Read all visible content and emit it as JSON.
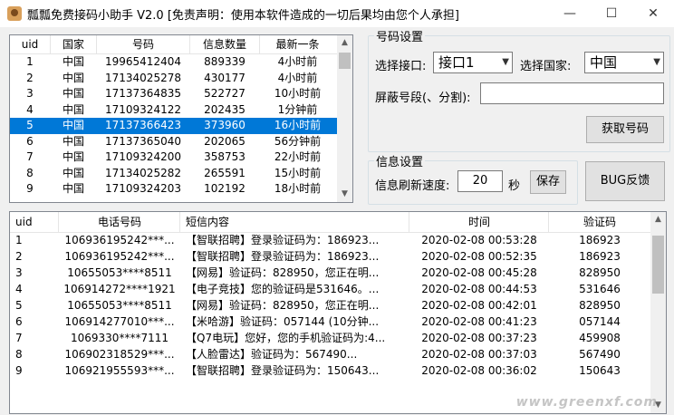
{
  "window": {
    "title": "瓢瓢免费接码小助手 V2.0 [免责声明：使用本软件造成的一切后果均由您个人承担]",
    "minimize": "—",
    "maximize": "☐",
    "close": "✕"
  },
  "numbers_table": {
    "columns": [
      "uid",
      "国家",
      "号码",
      "信息数量",
      "最新一条"
    ],
    "rows": [
      [
        "1",
        "中国",
        "19965412404",
        "889339",
        "4小时前"
      ],
      [
        "2",
        "中国",
        "17134025278",
        "430177",
        "4小时前"
      ],
      [
        "3",
        "中国",
        "17137364835",
        "522727",
        "10小时前"
      ],
      [
        "4",
        "中国",
        "17109324122",
        "202435",
        "1分钟前"
      ],
      [
        "5",
        "中国",
        "17137366423",
        "373960",
        "16小时前"
      ],
      [
        "6",
        "中国",
        "17137365040",
        "202065",
        "56分钟前"
      ],
      [
        "7",
        "中国",
        "17109324200",
        "358753",
        "22小时前"
      ],
      [
        "8",
        "中国",
        "17134025282",
        "265591",
        "15小时前"
      ],
      [
        "9",
        "中国",
        "17109324203",
        "102192",
        "18小时前"
      ]
    ],
    "selected_row": 4
  },
  "number_settings": {
    "legend": "号码设置",
    "interface_label": "选择接口:",
    "interface_value": "接口1",
    "country_label": "选择国家:",
    "country_value": "中国",
    "block_label": "屏蔽号段(、分割):",
    "block_value": "",
    "get_button": "获取号码"
  },
  "info_settings": {
    "legend": "信息设置",
    "refresh_label": "信息刷新速度:",
    "refresh_value": "20",
    "unit": "秒",
    "save_button": "保存"
  },
  "bug_button": "BUG反馈",
  "sms_table": {
    "columns": [
      "uid",
      "电话号码",
      "短信内容",
      "时间",
      "验证码"
    ],
    "rows": [
      [
        "1",
        "106936195242***...",
        "【智联招聘】登录验证码为：186923...",
        "2020-02-08 00:53:28",
        "186923"
      ],
      [
        "2",
        "106936195242***...",
        "【智联招聘】登录验证码为：186923...",
        "2020-02-08 00:52:35",
        "186923"
      ],
      [
        "3",
        "10655053****8511",
        "【网易】验证码：828950，您正在明...",
        "2020-02-08 00:45:28",
        "828950"
      ],
      [
        "4",
        "106914272****1921",
        "【电子竞技】您的验证码是531646。...",
        "2020-02-08 00:44:53",
        "531646"
      ],
      [
        "5",
        "10655053****8511",
        "【网易】验证码：828950，您正在明...",
        "2020-02-08 00:42:01",
        "828950"
      ],
      [
        "6",
        "106914277010***...",
        "【米哈游】验证码：057144 (10分钟...",
        "2020-02-08 00:41:23",
        "057144"
      ],
      [
        "7",
        "1069330****7111",
        "【Q7电玩】您好，您的手机验证码为:4...",
        "2020-02-08 00:37:23",
        "459908"
      ],
      [
        "8",
        "106902318529***...",
        "【人脸雷达】验证码为：567490...",
        "2020-02-08 00:37:03",
        "567490"
      ],
      [
        "9",
        "106921955593***...",
        "【智联招聘】登录验证码为：150643...",
        "2020-02-08 00:36:02",
        "150643"
      ]
    ]
  },
  "watermark": "www.greenxf.com"
}
